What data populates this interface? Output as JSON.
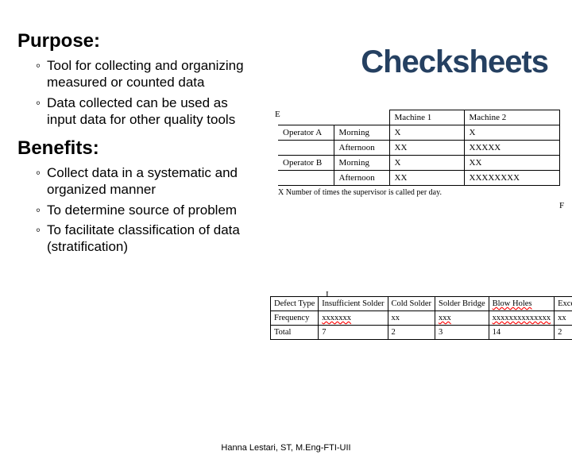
{
  "title": "Checksheets",
  "purpose": {
    "heading": "Purpose:",
    "items": [
      "Tool for collecting and organizing measured or counted data",
      "Data collected can be used as input data for other quality tools"
    ]
  },
  "benefits": {
    "heading": "Benefits:",
    "items": [
      "Collect data in a systematic and organized manner",
      "To determine source of problem",
      "To facilitate classification of data (stratification)"
    ]
  },
  "table1": {
    "markerE": "E",
    "markerF": "F",
    "headers": [
      "",
      "",
      "Machine 1",
      "Machine 2"
    ],
    "rows": [
      [
        "Operator A",
        "Morning",
        "X",
        "X"
      ],
      [
        "",
        "Afternoon",
        "XX",
        "XXXXX"
      ],
      [
        "Operator B",
        "Morning",
        "X",
        "XX"
      ],
      [
        "",
        "Afternoon",
        "XX",
        "XXXXXXXX"
      ]
    ],
    "note": "X  Number of times the supervisor is called per day."
  },
  "table2": {
    "markerI": "I",
    "headers": [
      "Defect Type",
      "Insufficient Solder",
      "Cold Solder",
      "Solder Bridge",
      "Blow Holes",
      "Excessive Solder"
    ],
    "freqLabel": "Frequency",
    "freq": [
      "xxxxxxx",
      "xx",
      "xxx",
      "xxxxxxxxxxxxxx",
      "xx"
    ],
    "totalLabel": "Total",
    "totals": [
      "7",
      "2",
      "3",
      "14",
      "2"
    ]
  },
  "footer": "Hanna Lestari, ST, M.Eng-FTI-UII"
}
